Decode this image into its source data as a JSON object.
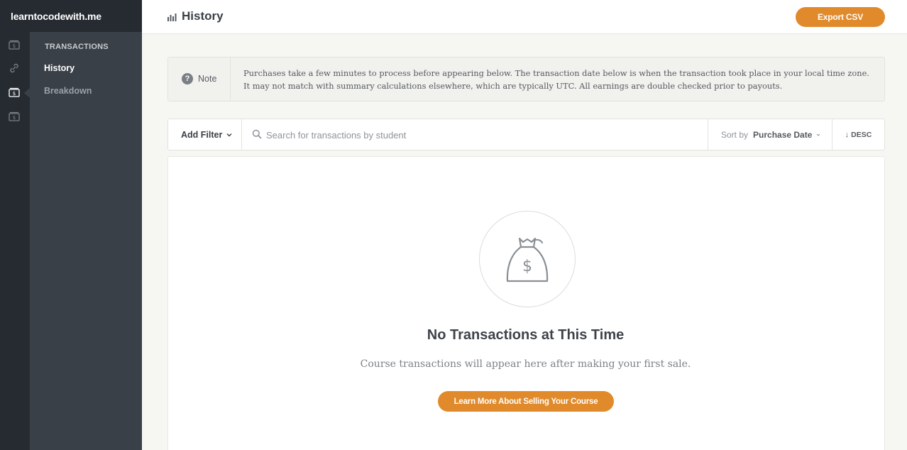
{
  "brand": "learntocodewith.me",
  "rail": {
    "icons": [
      "money-icon",
      "link-icon",
      "money-icon",
      "money-icon"
    ]
  },
  "sidebar": {
    "heading": "TRANSACTIONS",
    "items": [
      {
        "label": "History",
        "active": true
      },
      {
        "label": "Breakdown",
        "active": false
      }
    ]
  },
  "header": {
    "icon": "bar-chart-icon",
    "title": "History",
    "export_label": "Export CSV"
  },
  "note": {
    "label": "Note",
    "icon": "question-icon",
    "text": "Purchases take a few minutes to process before appearing below. The transaction date below is when the transaction took place in your local time zone. It may not match with summary calculations elsewhere, which are typically UTC. All earnings are double checked prior to payouts."
  },
  "filters": {
    "add_filter_label": "Add Filter",
    "search_placeholder": "Search for transactions by student",
    "sort_label": "Sort by",
    "sort_value": "Purchase Date",
    "order_label": "DESC"
  },
  "empty_state": {
    "icon": "money-bag-icon",
    "title": "No Transactions at This Time",
    "subtitle": "Course transactions will appear here after making your first sale.",
    "cta_label": "Learn More About Selling Your Course"
  },
  "colors": {
    "accent": "#e08a2b",
    "rail": "#262b31",
    "sidebar": "#3a4047",
    "background": "#f6f6f3"
  }
}
